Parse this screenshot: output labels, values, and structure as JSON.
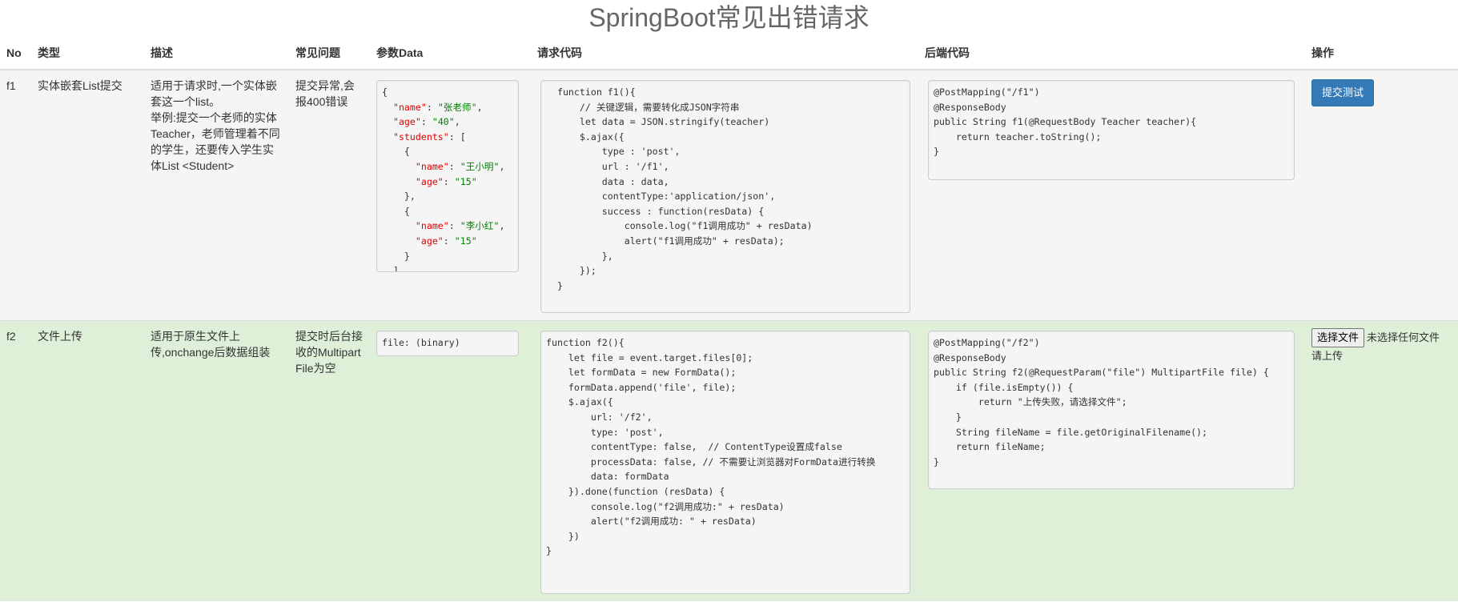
{
  "page": {
    "title": "SpringBoot常见出错请求"
  },
  "headers": {
    "no": "No",
    "type": "类型",
    "desc": "描述",
    "issue": "常见问题",
    "param": "参数Data",
    "req": "请求代码",
    "backend": "后端代码",
    "action": "操作"
  },
  "rows": [
    {
      "no": "f1",
      "type": "实体嵌套List提交",
      "desc": "适用于请求时,一个实体嵌套这一个list。\n举例:提交一个老师的实体Teacher，老师管理着不同的学生，还要传入学生实体List <Student>",
      "issue": "提交异常,会报400错误",
      "param": {
        "teacher_name": "张老师",
        "teacher_age": "40",
        "students": [
          {
            "name": "王小明",
            "age": "15"
          },
          {
            "name": "李小红",
            "age": "15"
          }
        ]
      },
      "req_code": "  function f1(){\n      // 关键逻辑，需要转化成JSON字符串\n      let data = JSON.stringify(teacher)\n      $.ajax({\n          type : 'post',\n          url : '/f1',\n          data : data,\n          contentType:'application/json',\n          success : function(resData) {\n              console.log(\"f1调用成功\" + resData)\n              alert(\"f1调用成功\" + resData);\n          },\n      });\n  }",
      "backend_code": "@PostMapping(\"/f1\")\n@ResponseBody\npublic String f1(@RequestBody Teacher teacher){\n    return teacher.toString();\n}",
      "action_label": "提交测试"
    },
    {
      "no": "f2",
      "type": "文件上传",
      "desc": "适用于原生文件上传,onchange后数据组装",
      "issue": "提交时后台接收的MultipartFile为空",
      "param_text": "file: (binary)",
      "req_code": "function f2(){\n    let file = event.target.files[0];\n    let formData = new FormData();\n    formData.append('file', file);\n    $.ajax({\n        url: '/f2',\n        type: 'post',\n        contentType: false,  // ContentType设置成false\n        processData: false, // 不需要让浏览器对FormData进行转换\n        data: formData\n    }).done(function (resData) {\n        console.log(\"f2调用成功:\" + resData)\n        alert(\"f2调用成功: \" + resData)\n    })\n}",
      "backend_code": "@PostMapping(\"/f2\")\n@ResponseBody\npublic String f2(@RequestParam(\"file\") MultipartFile file) {\n    if (file.isEmpty()) {\n        return \"上传失败，请选择文件\";\n    }\n    String fileName = file.getOriginalFilename();\n    return fileName;\n}",
      "file_button": "选择文件",
      "file_status": "未选择任何文件",
      "file_hint": "请上传"
    }
  ]
}
